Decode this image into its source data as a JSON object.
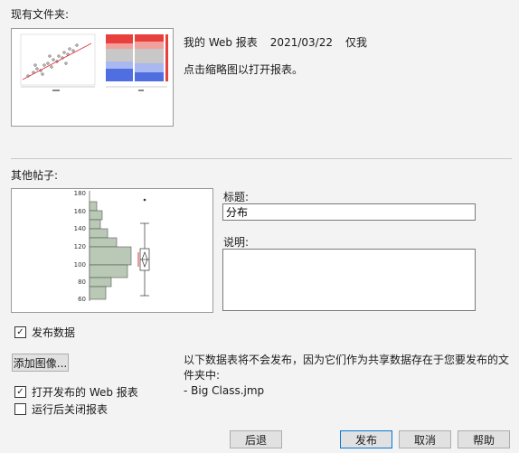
{
  "existing_folder": {
    "heading": "现有文件夹:",
    "post_title": "我的 Web 报表",
    "post_date": "2021/03/22",
    "post_visibility": "仅我",
    "hint": "点击缩略图以打开报表。"
  },
  "other_post": {
    "heading": "其他帖子:",
    "title_label": "标题:",
    "title_value": "分布",
    "description_label": "说明:",
    "description_value": "",
    "histogram": {
      "y_ticks": [
        "180",
        "160",
        "140",
        "120",
        "100",
        "80",
        "60"
      ]
    }
  },
  "options": {
    "publish_data_label": "发布数据",
    "publish_data_checked": true,
    "add_image_button": "添加图像...",
    "open_web_report_label": "打开发布的 Web 报表",
    "open_web_report_checked": true,
    "close_report_label": "运行后关闭报表",
    "close_report_checked": false
  },
  "notice": {
    "line1": "以下数据表将不会发布，因为它们作为共享数据存在于您要发布的文",
    "line2": "件夹中:",
    "item": "- Big Class.jmp"
  },
  "buttons": {
    "back": "后退",
    "publish": "发布",
    "cancel": "取消",
    "help": "帮助"
  },
  "colors": {
    "histogram_fill": "#b9c9b5",
    "scatter_line": "#e0303a",
    "mosaic_red": "#e8403c",
    "mosaic_blue": "#4f6fe0",
    "default_button_border": "#0078d7"
  }
}
